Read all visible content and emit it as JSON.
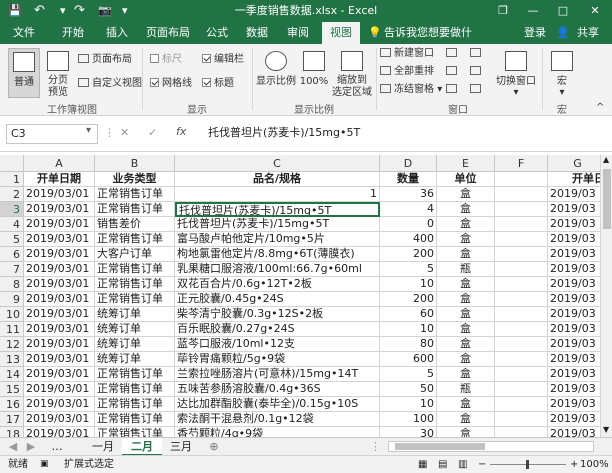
{
  "titlebar": {
    "title": "一季度销售数据.xlsx - Excel",
    "save_icon": "💾",
    "undo_icon": "↶",
    "redo_icon": "↷",
    "camera_icon": "📷",
    "restore_icon": "❐",
    "minimize_icon": "—",
    "maximize_icon": "□",
    "close_icon": "✕"
  },
  "tabs": {
    "items": [
      "文件",
      "开始",
      "插入",
      "页面布局",
      "公式",
      "数据",
      "审阅",
      "视图"
    ],
    "active": "视图",
    "tell_me": "告诉我您想要做什么...",
    "login": "登录",
    "share": "共享"
  },
  "ribbon": {
    "normal": "普通",
    "page_break_1": "分页",
    "page_break_2": "预览",
    "page_layout": "页面布局",
    "custom_view": "自定义视图",
    "group_workbook_views": "工作簿视图",
    "ruler": "标尺",
    "formula_bar": "编辑栏",
    "gridlines": "网格线",
    "headings": "标题",
    "group_show": "显示",
    "zoom": "显示比例",
    "zoom_100": "100%",
    "zoom_selection_1": "缩放到",
    "zoom_selection_2": "选定区域",
    "group_zoom": "显示比例",
    "new_window": "新建窗口",
    "arrange_all": "全部重排",
    "freeze_panes": "冻结窗格",
    "switch_windows": "切换窗口",
    "group_window": "窗口",
    "macros": "宏",
    "group_macros": "宏"
  },
  "formula_bar": {
    "name_box": "C3",
    "cancel": "✕",
    "enter": "✓",
    "fx": "fx",
    "formula": "托伐普坦片(苏麦卡)/15mg•5T"
  },
  "grid": {
    "col_headers": [
      "A",
      "B",
      "C",
      "D",
      "E",
      "F",
      "G"
    ],
    "row_numbers": [
      "1",
      "2",
      "3",
      "4",
      "5",
      "6",
      "7",
      "8",
      "9",
      "10",
      "11",
      "12",
      "13",
      "14",
      "15",
      "16",
      "17",
      "18"
    ],
    "header_row": [
      "开单日期",
      "业务类型",
      "品名/规格",
      "数量",
      "单位",
      "",
      "开单日"
    ],
    "rows": [
      [
        "2019/03/01",
        "正常销售订单",
        "",
        "36",
        "盒",
        "",
        "2019/03"
      ],
      [
        "2019/03/01",
        "正常销售订单",
        "托伐普坦片(苏麦卡)/15mg•5T",
        "4",
        "盒",
        "",
        "2019/03"
      ],
      [
        "2019/03/01",
        "销售差价",
        "托伐普坦片(苏麦卡)/15mg•5T",
        "0",
        "盒",
        "",
        "2019/03"
      ],
      [
        "2019/03/01",
        "正常销售订单",
        "富马酸卢帕他定片/10mg•5片",
        "400",
        "盒",
        "",
        "2019/03"
      ],
      [
        "2019/03/01",
        "大客户订单",
        "枸地氯雷他定片/8.8mg•6T(薄膜衣)",
        "200",
        "盒",
        "",
        "2019/03"
      ],
      [
        "2019/03/01",
        "正常销售订单",
        "乳果糖口服溶液/100ml:66.7g•60ml",
        "5",
        "瓶",
        "",
        "2019/03"
      ],
      [
        "2019/03/01",
        "正常销售订单",
        "双花百合片/0.6g•12T•2板",
        "10",
        "盒",
        "",
        "2019/03"
      ],
      [
        "2019/03/01",
        "正常销售订单",
        "正元胶囊/0.45g•24S",
        "200",
        "盒",
        "",
        "2019/03"
      ],
      [
        "2019/03/01",
        "统筹订单",
        "柴芩清宁胶囊/0.3g•12S•2板",
        "60",
        "盒",
        "",
        "2019/03"
      ],
      [
        "2019/03/01",
        "统筹订单",
        "百乐眠胶囊/0.27g•24S",
        "10",
        "盒",
        "",
        "2019/03"
      ],
      [
        "2019/03/01",
        "统筹订单",
        "蓝芩口服液/10ml•12支",
        "80",
        "盒",
        "",
        "2019/03"
      ],
      [
        "2019/03/01",
        "统筹订单",
        "荜铃胃痛颗粒/5g•9袋",
        "600",
        "盒",
        "",
        "2019/03"
      ],
      [
        "2019/03/01",
        "正常销售订单",
        "兰索拉唑肠溶片(可意林)/15mg•14T",
        "5",
        "盒",
        "",
        "2019/03"
      ],
      [
        "2019/03/01",
        "正常销售订单",
        "五味苦参肠溶胶囊/0.4g•36S",
        "50",
        "瓶",
        "",
        "2019/03"
      ],
      [
        "2019/03/01",
        "正常销售订单",
        "达比加群酯胶囊(泰毕全)/0.15g•10S",
        "10",
        "盒",
        "",
        "2019/03"
      ],
      [
        "2019/03/01",
        "正常销售订单",
        "索法酮干混悬剂/0.1g•12袋",
        "100",
        "盒",
        "",
        "2019/03"
      ],
      [
        "2019/03/01",
        "正常销售订单",
        "香芍颗粒/4g•9袋",
        "30",
        "盒",
        "",
        "2019/03"
      ]
    ],
    "c2_value": "1"
  },
  "sheets": {
    "items": [
      "一月",
      "二月",
      "三月"
    ],
    "active": "二月",
    "add": "⊕",
    "prev": "◀",
    "next": "▶"
  },
  "status": {
    "ready": "就绪",
    "mode": "扩展式选定",
    "zoom": "100%",
    "minus": "−",
    "plus": "+"
  },
  "colors": {
    "brand": "#217346"
  }
}
